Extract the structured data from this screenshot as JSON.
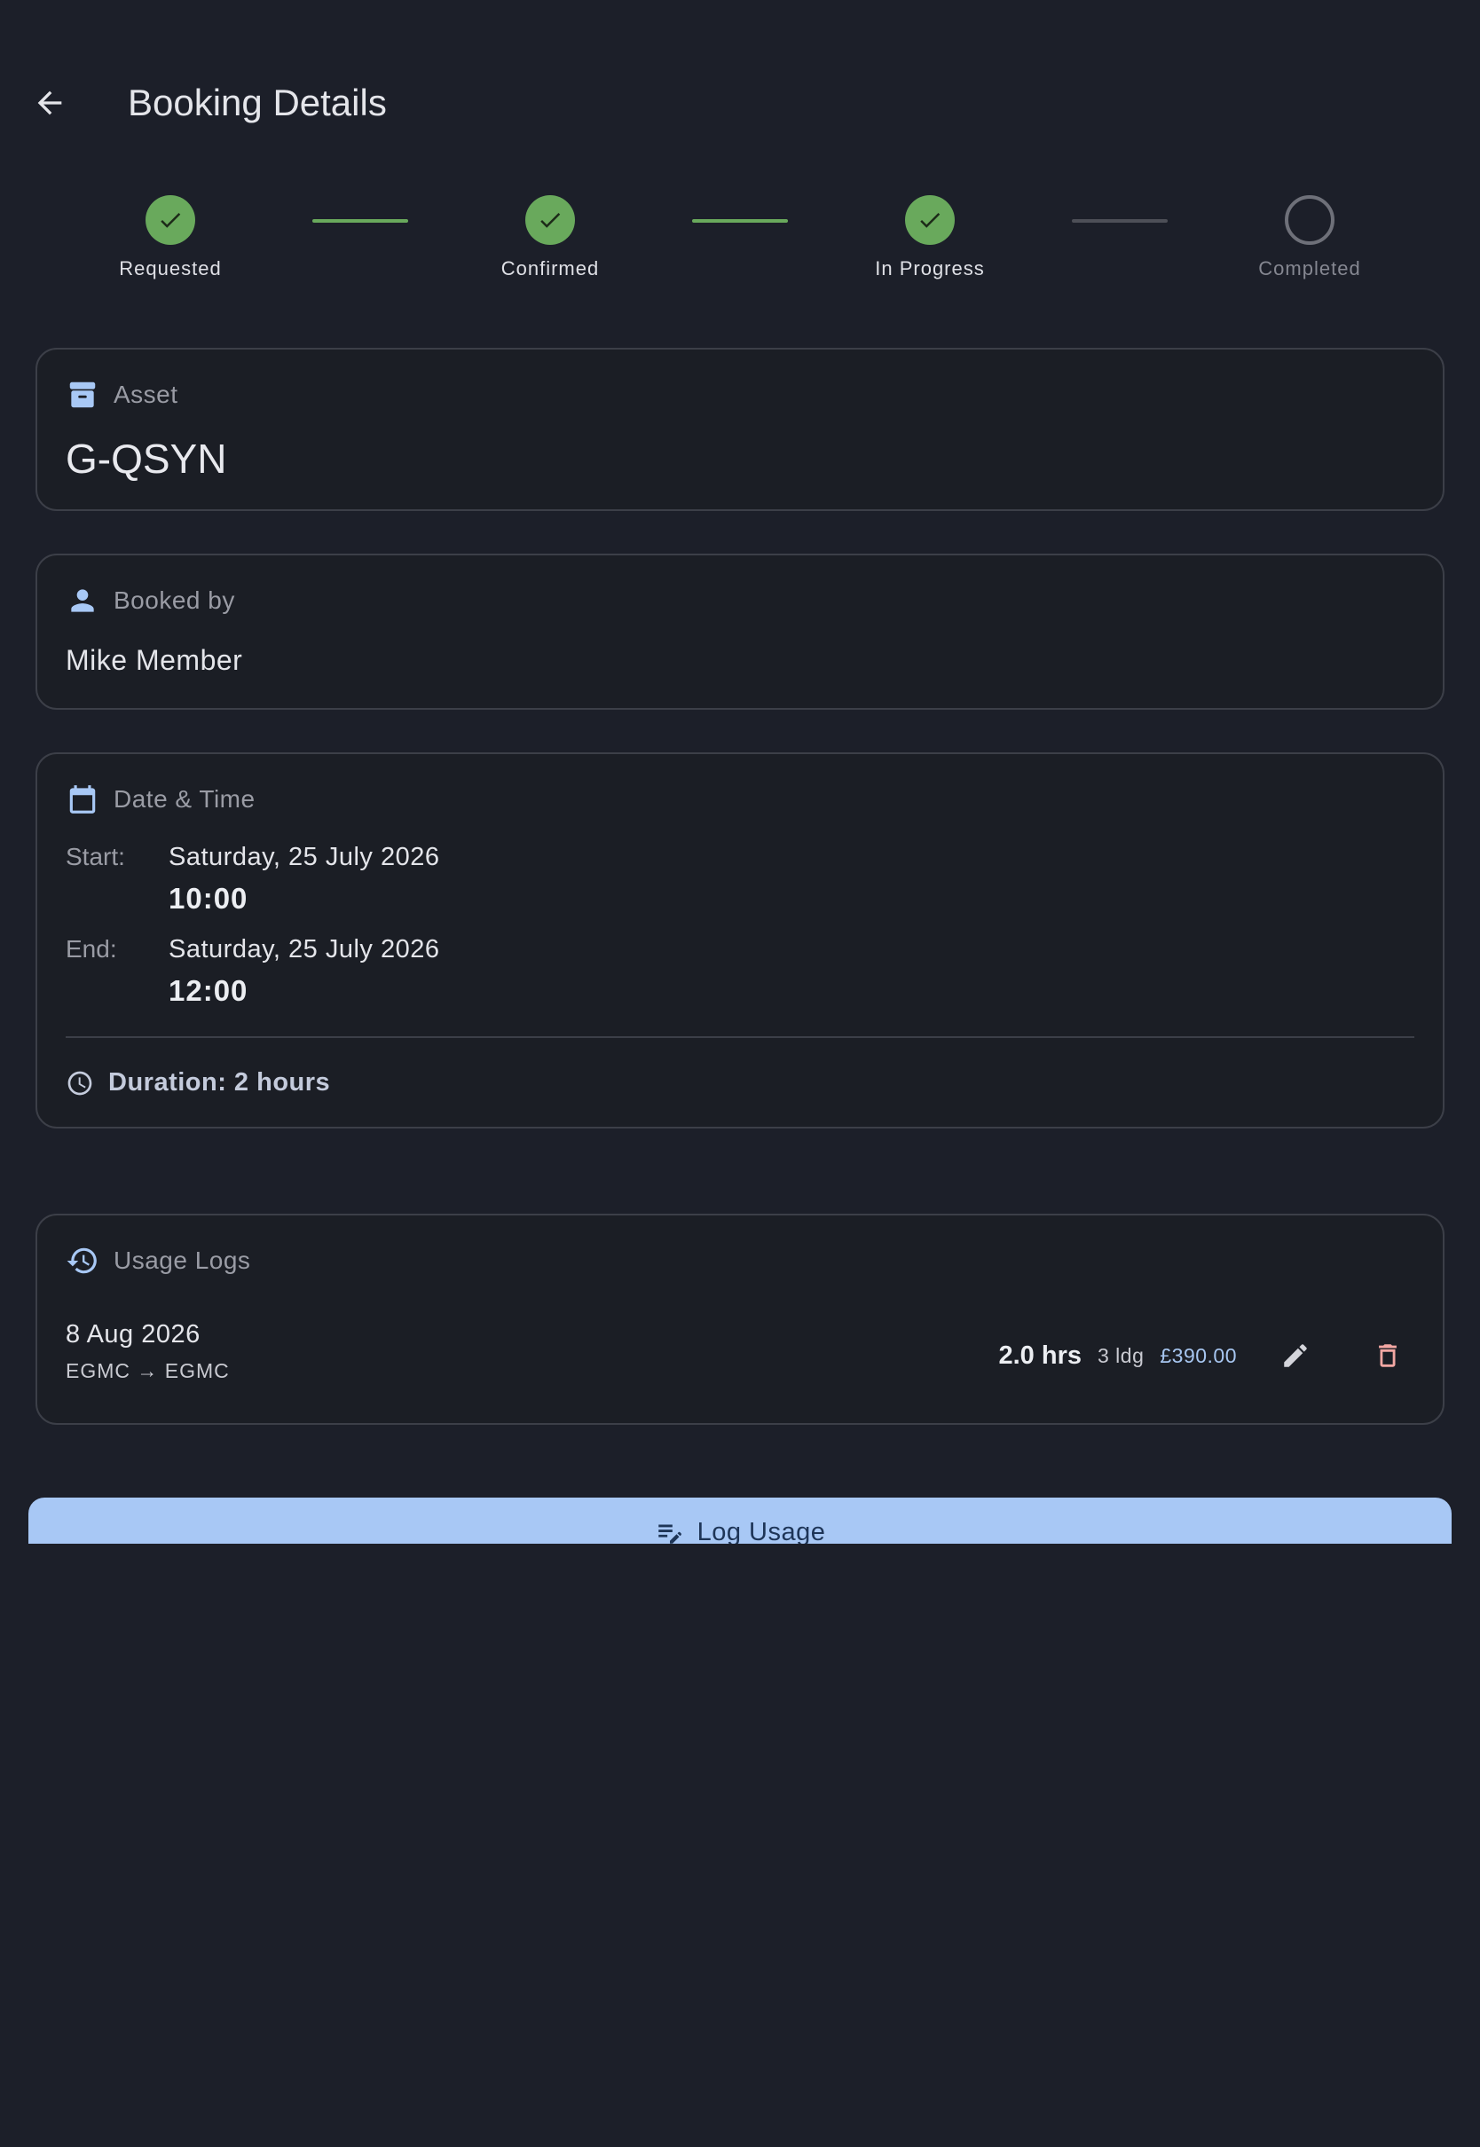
{
  "header": {
    "title": "Booking Details",
    "back_icon": "arrow-back-icon"
  },
  "stepper": {
    "steps": [
      {
        "label": "Requested",
        "state": "done"
      },
      {
        "label": "Confirmed",
        "state": "done"
      },
      {
        "label": "In Progress",
        "state": "done"
      },
      {
        "label": "Completed",
        "state": "pending"
      }
    ]
  },
  "asset": {
    "heading": "Asset",
    "value": "G-QSYN",
    "icon": "archive-box-icon"
  },
  "booked_by": {
    "heading": "Booked by",
    "value": "Mike Member",
    "icon": "person-icon"
  },
  "datetime": {
    "heading": "Date & Time",
    "icon": "calendar-icon",
    "start_label": "Start:",
    "start_date": "Saturday, 25 July 2026",
    "start_time": "10:00",
    "end_label": "End:",
    "end_date": "Saturday, 25 July 2026",
    "end_time": "12:00",
    "duration": "Duration: 2 hours"
  },
  "usage_logs": {
    "heading": "Usage Logs",
    "icon": "history-icon",
    "entries": [
      {
        "date": "8 Aug 2026",
        "route": "EGMC → EGMC",
        "hours": "2.0 hrs",
        "landings": "3 ldg",
        "cost": "£390.00"
      }
    ]
  },
  "actions": {
    "log_usage_label": "Log Usage"
  },
  "colors": {
    "background": "#1c1f29",
    "card": "#1b1e25",
    "accent_blue": "#a8c8f5",
    "success_green": "#69a95c",
    "delete_red": "#f2a7a3"
  }
}
